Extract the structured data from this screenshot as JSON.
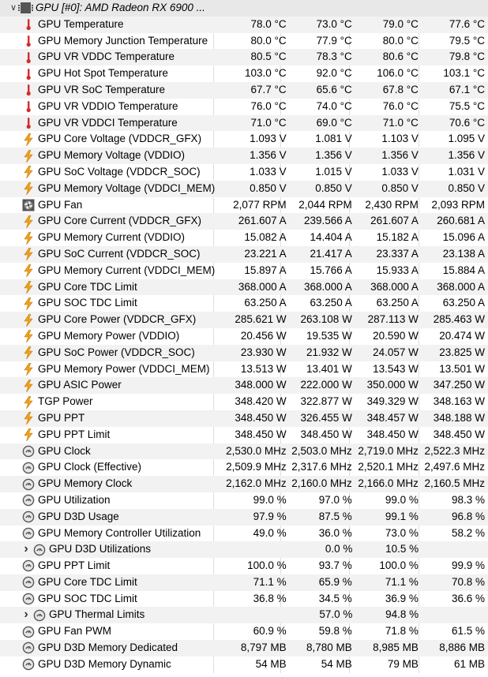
{
  "window": {
    "title": "GPU [#0]: AMD Radeon RX 6900 ..."
  },
  "colors": {
    "alt_row": "#f2f2f2",
    "thermo_red": "#d42b2b",
    "bolt_orange": "#f0a020",
    "clock_grey": "#555555"
  },
  "sensors": [
    {
      "icon": "thermometer-icon",
      "name": "GPU Temperature",
      "v": [
        "78.0 °C",
        "73.0 °C",
        "79.0 °C",
        "77.6 °C"
      ]
    },
    {
      "icon": "thermometer-icon",
      "name": "GPU Memory Junction Temperature",
      "v": [
        "80.0 °C",
        "77.9 °C",
        "80.0 °C",
        "79.5 °C"
      ]
    },
    {
      "icon": "thermometer-icon",
      "name": "GPU VR VDDC Temperature",
      "v": [
        "80.5 °C",
        "78.3 °C",
        "80.6 °C",
        "79.8 °C"
      ]
    },
    {
      "icon": "thermometer-icon",
      "name": "GPU Hot Spot Temperature",
      "v": [
        "103.0 °C",
        "92.0 °C",
        "106.0 °C",
        "103.1 °C"
      ]
    },
    {
      "icon": "thermometer-icon",
      "name": "GPU VR SoC Temperature",
      "v": [
        "67.7 °C",
        "65.6 °C",
        "67.8 °C",
        "67.1 °C"
      ]
    },
    {
      "icon": "thermometer-icon",
      "name": "GPU VR VDDIO Temperature",
      "v": [
        "76.0 °C",
        "74.0 °C",
        "76.0 °C",
        "75.5 °C"
      ]
    },
    {
      "icon": "thermometer-icon",
      "name": "GPU VR VDDCI Temperature",
      "v": [
        "71.0 °C",
        "69.0 °C",
        "71.0 °C",
        "70.6 °C"
      ]
    },
    {
      "icon": "lightning-icon",
      "name": "GPU Core Voltage (VDDCR_GFX)",
      "v": [
        "1.093 V",
        "1.081 V",
        "1.103 V",
        "1.095 V"
      ]
    },
    {
      "icon": "lightning-icon",
      "name": "GPU Memory Voltage (VDDIO)",
      "v": [
        "1.356 V",
        "1.356 V",
        "1.356 V",
        "1.356 V"
      ]
    },
    {
      "icon": "lightning-icon",
      "name": "GPU SoC Voltage (VDDCR_SOC)",
      "v": [
        "1.033 V",
        "1.015 V",
        "1.033 V",
        "1.031 V"
      ]
    },
    {
      "icon": "lightning-icon",
      "name": "GPU Memory Voltage (VDDCI_MEM)",
      "v": [
        "0.850 V",
        "0.850 V",
        "0.850 V",
        "0.850 V"
      ]
    },
    {
      "icon": "fan-icon",
      "name": "GPU Fan",
      "v": [
        "2,077 RPM",
        "2,044 RPM",
        "2,430 RPM",
        "2,093 RPM"
      ]
    },
    {
      "icon": "lightning-icon",
      "name": "GPU Core Current (VDDCR_GFX)",
      "v": [
        "261.607 A",
        "239.566 A",
        "261.607 A",
        "260.681 A"
      ]
    },
    {
      "icon": "lightning-icon",
      "name": "GPU Memory Current (VDDIO)",
      "v": [
        "15.082 A",
        "14.404 A",
        "15.182 A",
        "15.096 A"
      ]
    },
    {
      "icon": "lightning-icon",
      "name": "GPU SoC Current (VDDCR_SOC)",
      "v": [
        "23.221 A",
        "21.417 A",
        "23.337 A",
        "23.138 A"
      ]
    },
    {
      "icon": "lightning-icon",
      "name": "GPU Memory Current (VDDCI_MEM)",
      "v": [
        "15.897 A",
        "15.766 A",
        "15.933 A",
        "15.884 A"
      ]
    },
    {
      "icon": "lightning-icon",
      "name": "GPU Core TDC Limit",
      "v": [
        "368.000 A",
        "368.000 A",
        "368.000 A",
        "368.000 A"
      ]
    },
    {
      "icon": "lightning-icon",
      "name": "GPU SOC TDC Limit",
      "v": [
        "63.250 A",
        "63.250 A",
        "63.250 A",
        "63.250 A"
      ]
    },
    {
      "icon": "lightning-icon",
      "name": "GPU Core Power (VDDCR_GFX)",
      "v": [
        "285.621 W",
        "263.108 W",
        "287.113 W",
        "285.463 W"
      ]
    },
    {
      "icon": "lightning-icon",
      "name": "GPU Memory Power (VDDIO)",
      "v": [
        "20.456 W",
        "19.535 W",
        "20.590 W",
        "20.474 W"
      ]
    },
    {
      "icon": "lightning-icon",
      "name": "GPU SoC Power (VDDCR_SOC)",
      "v": [
        "23.930 W",
        "21.932 W",
        "24.057 W",
        "23.825 W"
      ]
    },
    {
      "icon": "lightning-icon",
      "name": "GPU Memory Power (VDDCI_MEM)",
      "v": [
        "13.513 W",
        "13.401 W",
        "13.543 W",
        "13.501 W"
      ]
    },
    {
      "icon": "lightning-icon",
      "name": "GPU ASIC Power",
      "v": [
        "348.000 W",
        "222.000 W",
        "350.000 W",
        "347.250 W"
      ]
    },
    {
      "icon": "lightning-icon",
      "name": "TGP Power",
      "v": [
        "348.420 W",
        "322.877 W",
        "349.329 W",
        "348.163 W"
      ]
    },
    {
      "icon": "lightning-icon",
      "name": "GPU PPT",
      "v": [
        "348.450 W",
        "326.455 W",
        "348.457 W",
        "348.188 W"
      ]
    },
    {
      "icon": "lightning-icon",
      "name": "GPU PPT Limit",
      "v": [
        "348.450 W",
        "348.450 W",
        "348.450 W",
        "348.450 W"
      ]
    },
    {
      "icon": "clock-icon",
      "name": "GPU Clock",
      "v": [
        "2,530.0 MHz",
        "2,503.0 MHz",
        "2,719.0 MHz",
        "2,522.3 MHz"
      ]
    },
    {
      "icon": "clock-icon",
      "name": "GPU Clock (Effective)",
      "v": [
        "2,509.9 MHz",
        "2,317.6 MHz",
        "2,520.1 MHz",
        "2,497.6 MHz"
      ]
    },
    {
      "icon": "clock-icon",
      "name": "GPU Memory Clock",
      "v": [
        "2,162.0 MHz",
        "2,160.0 MHz",
        "2,166.0 MHz",
        "2,160.5 MHz"
      ]
    },
    {
      "icon": "clock-icon",
      "name": "GPU Utilization",
      "v": [
        "99.0 %",
        "97.0 %",
        "99.0 %",
        "98.3 %"
      ]
    },
    {
      "icon": "clock-icon",
      "name": "GPU D3D Usage",
      "v": [
        "97.9 %",
        "87.5 %",
        "99.1 %",
        "96.8 %"
      ]
    },
    {
      "icon": "clock-icon",
      "name": "GPU Memory Controller Utilization",
      "v": [
        "49.0 %",
        "36.0 %",
        "73.0 %",
        "58.2 %"
      ]
    },
    {
      "icon": "clock-icon",
      "name": "GPU D3D Utilizations",
      "group": true,
      "v": [
        "",
        "0.0 %",
        "10.5 %",
        ""
      ]
    },
    {
      "icon": "clock-icon",
      "name": "GPU PPT Limit",
      "v": [
        "100.0 %",
        "93.7 %",
        "100.0 %",
        "99.9 %"
      ]
    },
    {
      "icon": "clock-icon",
      "name": "GPU Core TDC Limit",
      "v": [
        "71.1 %",
        "65.9 %",
        "71.1 %",
        "70.8 %"
      ]
    },
    {
      "icon": "clock-icon",
      "name": "GPU SOC TDC Limit",
      "v": [
        "36.8 %",
        "34.5 %",
        "36.9 %",
        "36.6 %"
      ]
    },
    {
      "icon": "clock-icon",
      "name": "GPU Thermal Limits",
      "group": true,
      "v": [
        "",
        "57.0 %",
        "94.8 %",
        ""
      ]
    },
    {
      "icon": "clock-icon",
      "name": "GPU Fan PWM",
      "v": [
        "60.9 %",
        "59.8 %",
        "71.8 %",
        "61.5 %"
      ]
    },
    {
      "icon": "clock-icon",
      "name": "GPU D3D Memory Dedicated",
      "v": [
        "8,797 MB",
        "8,780 MB",
        "8,985 MB",
        "8,886 MB"
      ]
    },
    {
      "icon": "clock-icon",
      "name": "GPU D3D Memory Dynamic",
      "v": [
        "54 MB",
        "54 MB",
        "79 MB",
        "61 MB"
      ]
    }
  ]
}
